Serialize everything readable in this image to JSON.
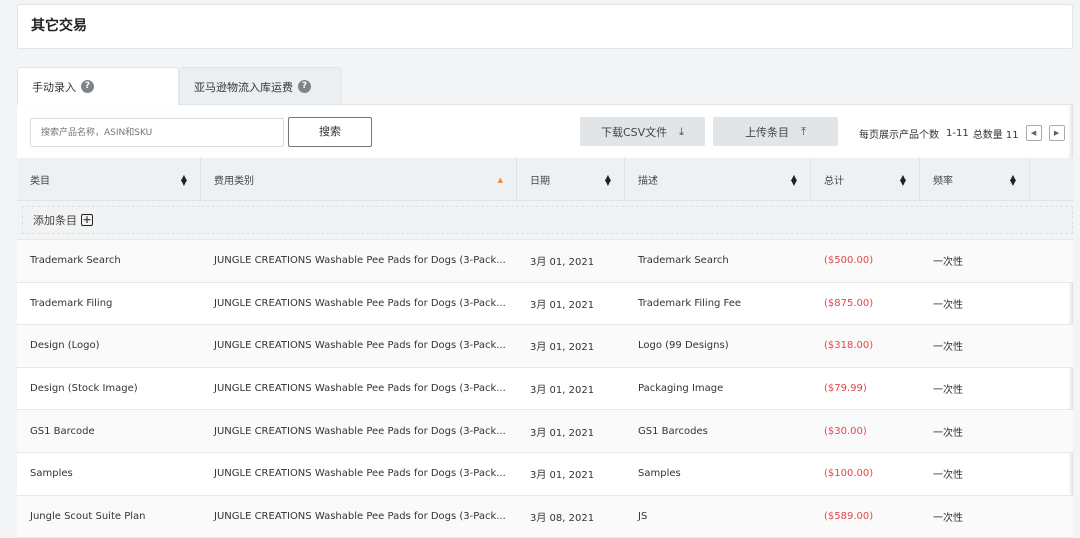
{
  "header": {
    "title": "其它交易"
  },
  "tabs": [
    {
      "label": "手动录入"
    },
    {
      "label": "亚马逊物流入库运费"
    }
  ],
  "toolbar": {
    "search_placeholder": "搜索产品名称，ASIN和SKU",
    "search_label": "搜索",
    "download_label": "下载CSV文件",
    "upload_label": "上传条目"
  },
  "pagination": {
    "per_page_label": "每页展示产品个数",
    "range": "1-11",
    "total_label": "总数量 11"
  },
  "columns": [
    "类目",
    "费用类别",
    "日期",
    "描述",
    "总计",
    "频率"
  ],
  "add_label": "添加条目",
  "accent_negative": "#e0474c",
  "rows": [
    {
      "category": "Trademark Search",
      "fee": "JUNGLE CREATIONS Washable Pee Pads for Dogs (3-Pack...",
      "date": "3月 01, 2021",
      "desc": "Trademark Search",
      "total": "($500.00)",
      "freq": "一次性"
    },
    {
      "category": "Trademark Filing",
      "fee": "JUNGLE CREATIONS Washable Pee Pads for Dogs (3-Pack...",
      "date": "3月 01, 2021",
      "desc": "Trademark Filing Fee",
      "total": "($875.00)",
      "freq": "一次性"
    },
    {
      "category": "Design (Logo)",
      "fee": "JUNGLE CREATIONS Washable Pee Pads for Dogs (3-Pack...",
      "date": "3月 01, 2021",
      "desc": "Logo (99 Designs)",
      "total": "($318.00)",
      "freq": "一次性"
    },
    {
      "category": "Design (Stock Image)",
      "fee": "JUNGLE CREATIONS Washable Pee Pads for Dogs (3-Pack...",
      "date": "3月 01, 2021",
      "desc": "Packaging Image",
      "total": "($79.99)",
      "freq": "一次性"
    },
    {
      "category": "GS1 Barcode",
      "fee": "JUNGLE CREATIONS Washable Pee Pads for Dogs (3-Pack...",
      "date": "3月 01, 2021",
      "desc": "GS1 Barcodes",
      "total": "($30.00)",
      "freq": "一次性"
    },
    {
      "category": "Samples",
      "fee": "JUNGLE CREATIONS Washable Pee Pads for Dogs (3-Pack...",
      "date": "3月 01, 2021",
      "desc": "Samples",
      "total": "($100.00)",
      "freq": "一次性"
    },
    {
      "category": "Jungle Scout Suite Plan",
      "fee": "JUNGLE CREATIONS Washable Pee Pads for Dogs (3-Pack...",
      "date": "3月 08, 2021",
      "desc": "JS",
      "total": "($589.00)",
      "freq": "一次性"
    }
  ]
}
